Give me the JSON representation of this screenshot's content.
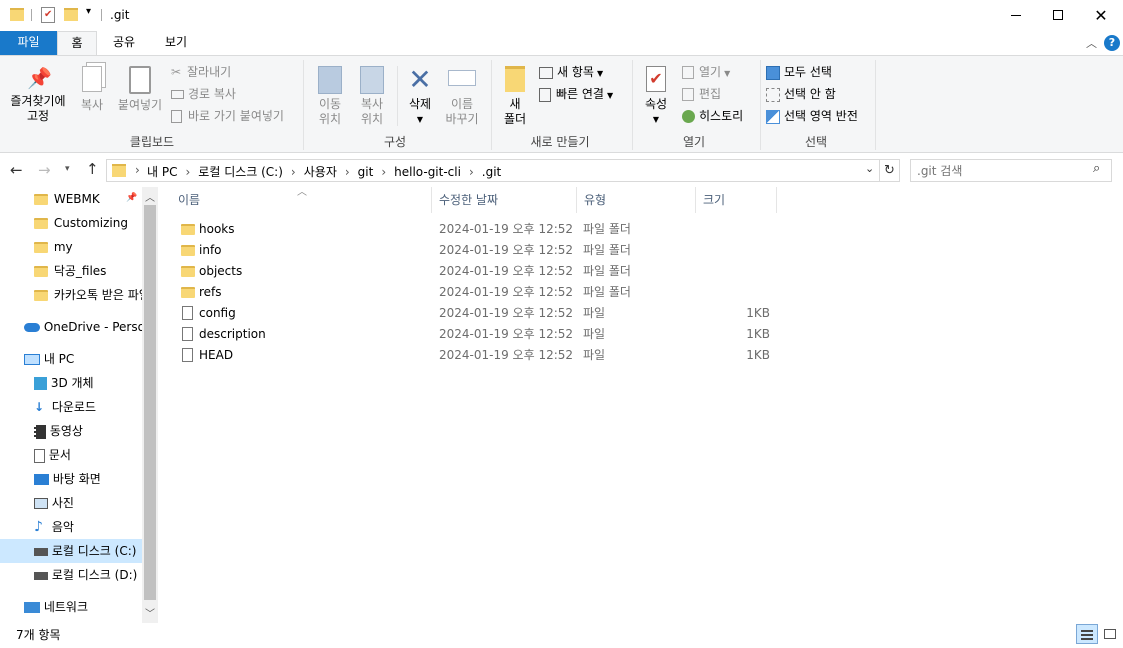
{
  "window": {
    "title": ".git"
  },
  "ribbon_tabs": [
    "파일",
    "홈",
    "공유",
    "보기"
  ],
  "clipboard": {
    "pin_label_1": "즐겨찾기에",
    "pin_label_2": "고정",
    "copy": "복사",
    "paste": "붙여넣기",
    "cut": "잘라내기",
    "copy_path": "경로 복사",
    "paste_shortcut": "바로 가기 붙여넣기",
    "group": "클립보드"
  },
  "organize": {
    "move_1": "이동",
    "move_2": "위치",
    "copy_1": "복사",
    "copy_2": "위치",
    "delete": "삭제",
    "rename_1": "이름",
    "rename_2": "바꾸기",
    "group": "구성"
  },
  "new": {
    "folder_1": "새",
    "folder_2": "폴더",
    "new_item": "새 항목",
    "easy_access": "빠른 연결",
    "group": "새로 만들기"
  },
  "open": {
    "properties": "속성",
    "open": "열기",
    "edit": "편집",
    "history": "히스토리",
    "group": "열기"
  },
  "select": {
    "all": "모두 선택",
    "none": "선택 안 함",
    "invert": "선택 영역 반전",
    "group": "선택"
  },
  "address": {
    "crumbs": [
      "내 PC",
      "로컬 디스크 (C:)",
      "사용자",
      "git",
      "hello-git-cli",
      ".git"
    ],
    "search_placeholder": ".git 검색"
  },
  "nav": {
    "quick": [
      "WEBMK",
      "Customizing",
      "my",
      "닥공_files",
      "카카오톡 받은 파일"
    ],
    "onedrive": "OneDrive - Personal",
    "thispc": "내 PC",
    "pc_items": [
      "3D 개체",
      "다운로드",
      "동영상",
      "문서",
      "바탕 화면",
      "사진",
      "음악",
      "로컬 디스크 (C:)",
      "로컬 디스크 (D:)"
    ],
    "network": "네트워크"
  },
  "columns": {
    "name": "이름",
    "modified": "수정한 날짜",
    "type": "유형",
    "size": "크기"
  },
  "files": [
    {
      "name": "hooks",
      "modified": "2024-01-19 오후 12:52",
      "type": "파일 폴더",
      "size": "",
      "kind": "folder"
    },
    {
      "name": "info",
      "modified": "2024-01-19 오후 12:52",
      "type": "파일 폴더",
      "size": "",
      "kind": "folder"
    },
    {
      "name": "objects",
      "modified": "2024-01-19 오후 12:52",
      "type": "파일 폴더",
      "size": "",
      "kind": "folder"
    },
    {
      "name": "refs",
      "modified": "2024-01-19 오후 12:52",
      "type": "파일 폴더",
      "size": "",
      "kind": "folder"
    },
    {
      "name": "config",
      "modified": "2024-01-19 오후 12:52",
      "type": "파일",
      "size": "1KB",
      "kind": "file"
    },
    {
      "name": "description",
      "modified": "2024-01-19 오후 12:52",
      "type": "파일",
      "size": "1KB",
      "kind": "file"
    },
    {
      "name": "HEAD",
      "modified": "2024-01-19 오후 12:52",
      "type": "파일",
      "size": "1KB",
      "kind": "file"
    }
  ],
  "status": {
    "count": "7개 항목"
  },
  "colors": {
    "accent": "#1979ca",
    "selected": "#cce8ff"
  }
}
